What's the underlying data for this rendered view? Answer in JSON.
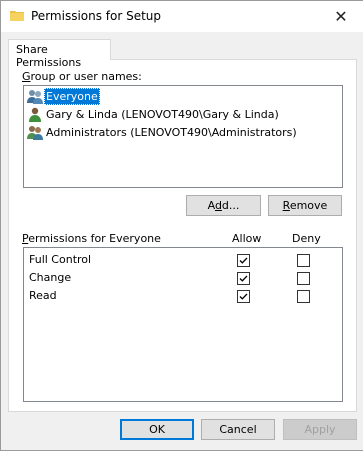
{
  "window": {
    "title": "Permissions for Setup",
    "close_glyph": "✕"
  },
  "tab": {
    "label": "Share Permissions"
  },
  "group_label": {
    "mnemonic": "G",
    "rest": "roup or user names:"
  },
  "users": [
    {
      "name": "Everyone",
      "icon": "group-icon",
      "selected": true
    },
    {
      "name": "Gary & Linda (LENOVOT490\\Gary & Linda)",
      "icon": "user-icon",
      "selected": false
    },
    {
      "name": "Administrators (LENOVOT490\\Administrators)",
      "icon": "group-icon",
      "selected": false
    }
  ],
  "buttons": {
    "add": {
      "pre": "A",
      "mnemonic": "d",
      "post": "d..."
    },
    "remove": {
      "mnemonic": "R",
      "post": "emove"
    },
    "ok": "OK",
    "cancel": "Cancel",
    "apply": "Apply"
  },
  "permissions_header": {
    "mnemonic": "P",
    "rest": "ermissions for Everyone",
    "allow": "Allow",
    "deny": "Deny"
  },
  "permissions": [
    {
      "name": "Full Control",
      "allow": true,
      "deny": false
    },
    {
      "name": "Change",
      "allow": true,
      "deny": false
    },
    {
      "name": "Read",
      "allow": true,
      "deny": false
    }
  ],
  "colors": {
    "selection": "#0078d7",
    "default_button_border": "#0078d7"
  }
}
